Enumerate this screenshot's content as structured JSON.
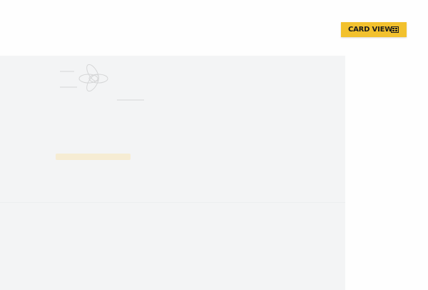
{
  "toolbar": {
    "card_view_label": "CARD VIEW",
    "card_view_icon": "card-grid-icon",
    "accent_color": "#f2c12e"
  },
  "content": {
    "panel_color": "#f3f4f5",
    "logo_icon": "flower-logo-icon"
  }
}
